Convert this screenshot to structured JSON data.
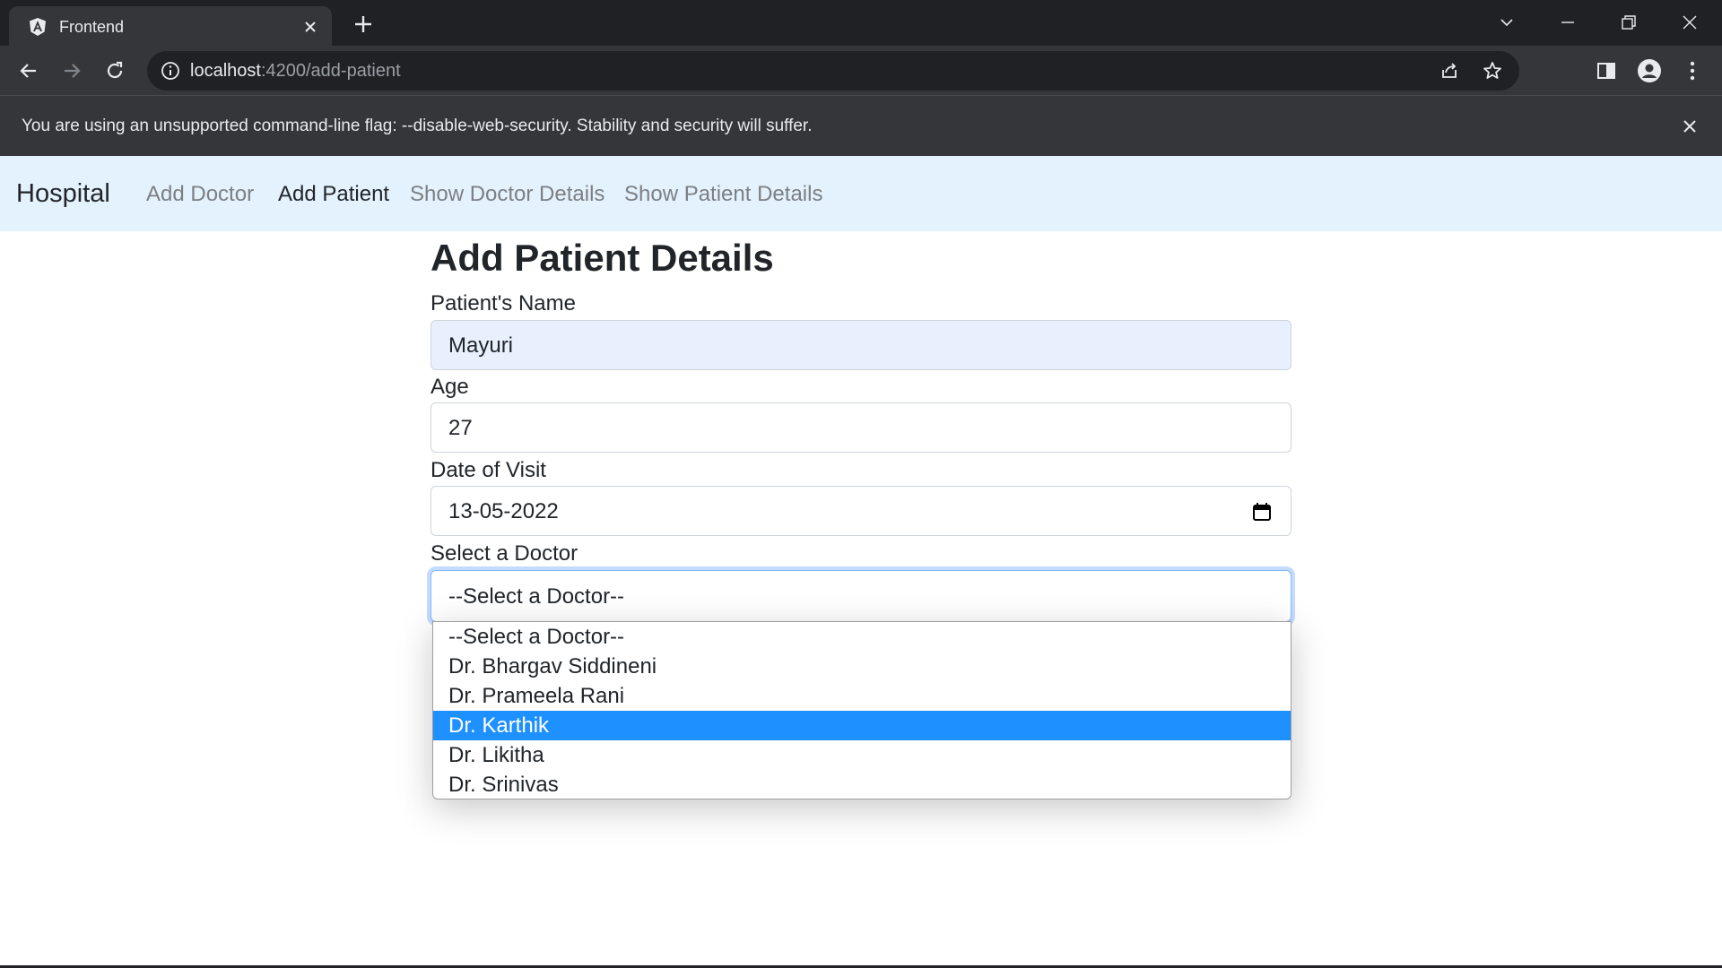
{
  "browser": {
    "tab_title": "Frontend",
    "url_host": "localhost",
    "url_rest": ":4200/add-patient",
    "infobar_message": "You are using an unsupported command-line flag: --disable-web-security. Stability and security will suffer."
  },
  "navbar": {
    "brand": "Hospital",
    "links": [
      {
        "label": "Add Doctor",
        "active": false
      },
      {
        "label": "Add Patient",
        "active": true
      },
      {
        "label": "Show Doctor Details",
        "active": false
      },
      {
        "label": "Show Patient Details",
        "active": false
      }
    ]
  },
  "form": {
    "title": "Add Patient Details",
    "name_label": "Patient's Name",
    "name_value": "Mayuri",
    "age_label": "Age",
    "age_value": "27",
    "date_label": "Date of Visit",
    "date_value": "13-05-2022",
    "doctor_label": "Select a Doctor",
    "doctor_value": "--Select a Doctor--",
    "doctor_options": [
      "--Select a Doctor--",
      "Dr. Bhargav Siddineni",
      "Dr. Prameela Rani",
      "Dr. Karthik",
      "Dr. Likitha",
      "Dr. Srinivas"
    ],
    "highlighted_option": "Dr. Karthik"
  },
  "colors": {
    "navbar_bg": "#e3f2fd",
    "autofill_bg": "#e8f0fe",
    "option_highlight": "#1e90ff"
  }
}
